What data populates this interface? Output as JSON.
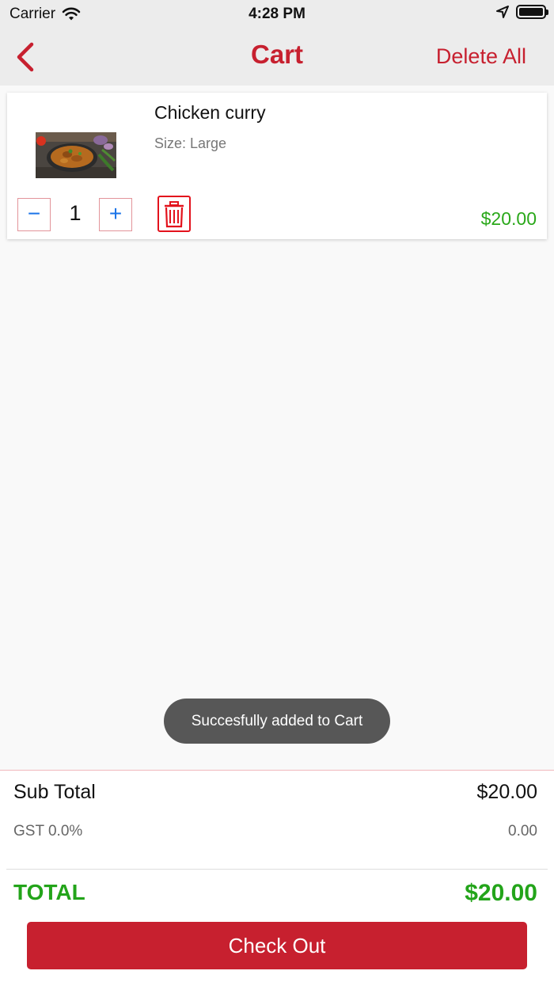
{
  "status_bar": {
    "carrier": "Carrier",
    "time": "4:28 PM",
    "icons": [
      "wifi-icon",
      "location-arrow-icon",
      "battery-icon"
    ]
  },
  "navbar": {
    "back_icon": "chevron-left-icon",
    "title": "Cart",
    "delete_all": "Delete All"
  },
  "cart_items": [
    {
      "name": "Chicken curry",
      "size": "Size: Large",
      "quantity": "1",
      "minus": "−",
      "plus": "+",
      "price": "$20.00",
      "image": "chicken-curry-photo",
      "delete_icon": "trash-icon"
    }
  ],
  "toast": "Succesfully added to Cart",
  "summary": {
    "subtotal_label": "Sub Total",
    "subtotal_value": "$20.00",
    "gst_label": "GST 0.0%",
    "gst_value": "0.00",
    "total_label": "TOTAL",
    "total_value": "$20.00"
  },
  "checkout": "Check Out",
  "colors": {
    "accent": "#c7202f",
    "price_green": "#2aa81a",
    "qty_blue": "#1a73e8",
    "toast_bg": "#575757"
  }
}
